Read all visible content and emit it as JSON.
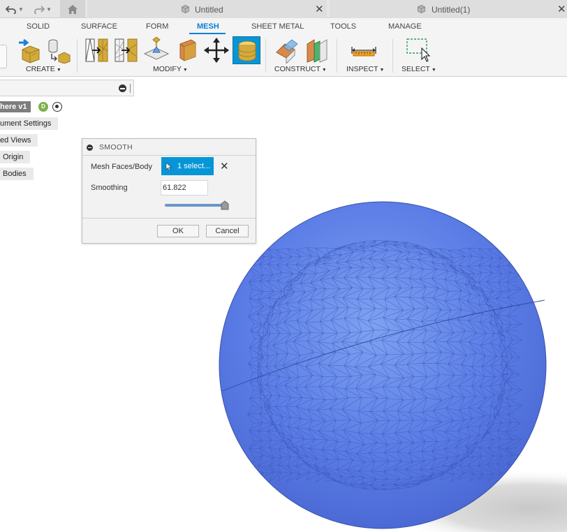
{
  "tabs": {
    "home_icon": "home-icon",
    "documents": [
      {
        "title": "Untitled"
      },
      {
        "title": "Untitled(1)"
      }
    ]
  },
  "ribbon": {
    "tabs": [
      "SOLID",
      "SURFACE",
      "FORM",
      "MESH",
      "SHEET METAL",
      "TOOLS",
      "MANAGE"
    ],
    "active_tab": "MESH",
    "groups": {
      "create": "CREATE",
      "modify": "MODIFY",
      "construct": "CONSTRUCT",
      "inspect": "INSPECT",
      "select": "SELECT"
    }
  },
  "browser": {
    "root": "here v1",
    "badge": "D",
    "items": [
      "ument Settings",
      "ed Views",
      "Origin",
      "Bodies"
    ]
  },
  "dialog": {
    "title": "SMOOTH",
    "mesh_label": "Mesh Faces/Body",
    "select_label": "1 select...",
    "smoothing_label": "Smoothing",
    "smoothing_value": "61.822",
    "slider_level": 0.92,
    "ok_label": "OK",
    "cancel_label": "Cancel"
  },
  "colors": {
    "accent": "#0a7fd6",
    "select_button": "#0696d7",
    "mesh_fill": "#5b7de6",
    "mesh_edge": "#3d56b8"
  }
}
